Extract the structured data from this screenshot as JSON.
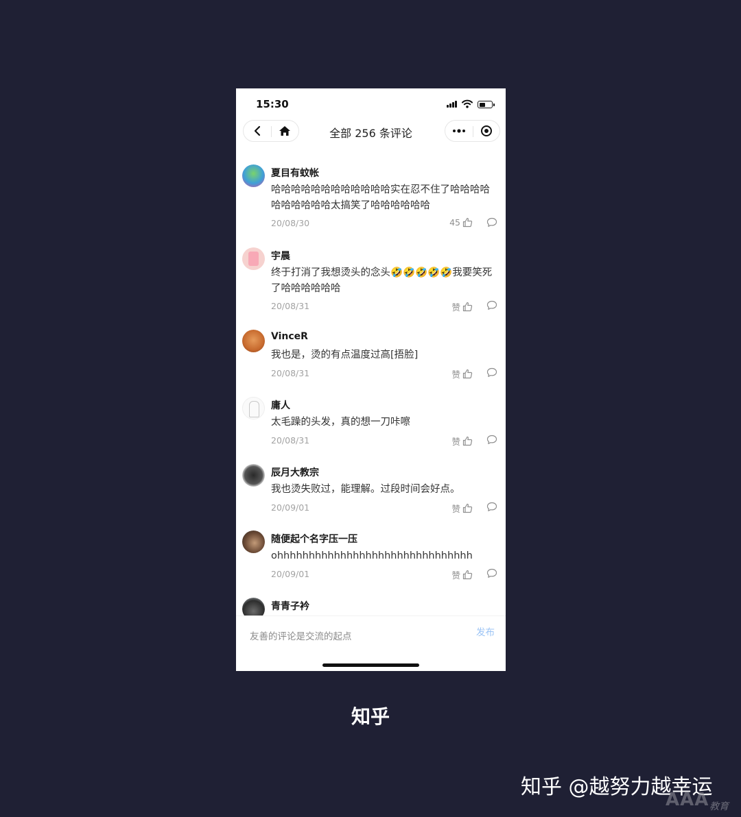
{
  "status_bar": {
    "time": "15:30"
  },
  "nav": {
    "title": "全部 256 条评论"
  },
  "like_label": "赞",
  "comments": [
    {
      "name": "夏目有蚊帐",
      "text": "哈哈哈哈哈哈哈哈哈哈哈哈实在忍不住了哈哈哈哈哈哈哈哈哈哈太搞笑了哈哈哈哈哈哈",
      "date": "20/08/30",
      "likes": "45"
    },
    {
      "name": "宇晨",
      "text": "终于打消了我想烫头的念头🤣🤣🤣🤣🤣我要笑死了哈哈哈哈哈哈",
      "date": "20/08/31",
      "likes": "赞"
    },
    {
      "name": "VinceR",
      "text": "我也是，烫的有点温度过高[捂脸]",
      "date": "20/08/31",
      "likes": "赞"
    },
    {
      "name": "庸人",
      "text": "太毛躁的头发，真的想一刀咔嚓",
      "date": "20/08/31",
      "likes": "赞"
    },
    {
      "name": "辰月大教宗",
      "text": "我也烫失败过，能理解。过段时间会好点。",
      "date": "20/09/01",
      "likes": "赞"
    },
    {
      "name": "随便起个名字压一压",
      "text": "ohhhhhhhhhhhhhhhhhhhhhhhhhhhhhhh",
      "date": "20/09/01",
      "likes": "赞"
    },
    {
      "name": "青青子衿",
      "text": "",
      "date": "",
      "likes": ""
    }
  ],
  "input": {
    "placeholder": "友善的评论是交流的起点",
    "publish": "发布"
  },
  "caption": "知乎",
  "watermark": "知乎 @越努力越幸运",
  "corner_logo": {
    "main": "AAA",
    "sub": "教育"
  }
}
